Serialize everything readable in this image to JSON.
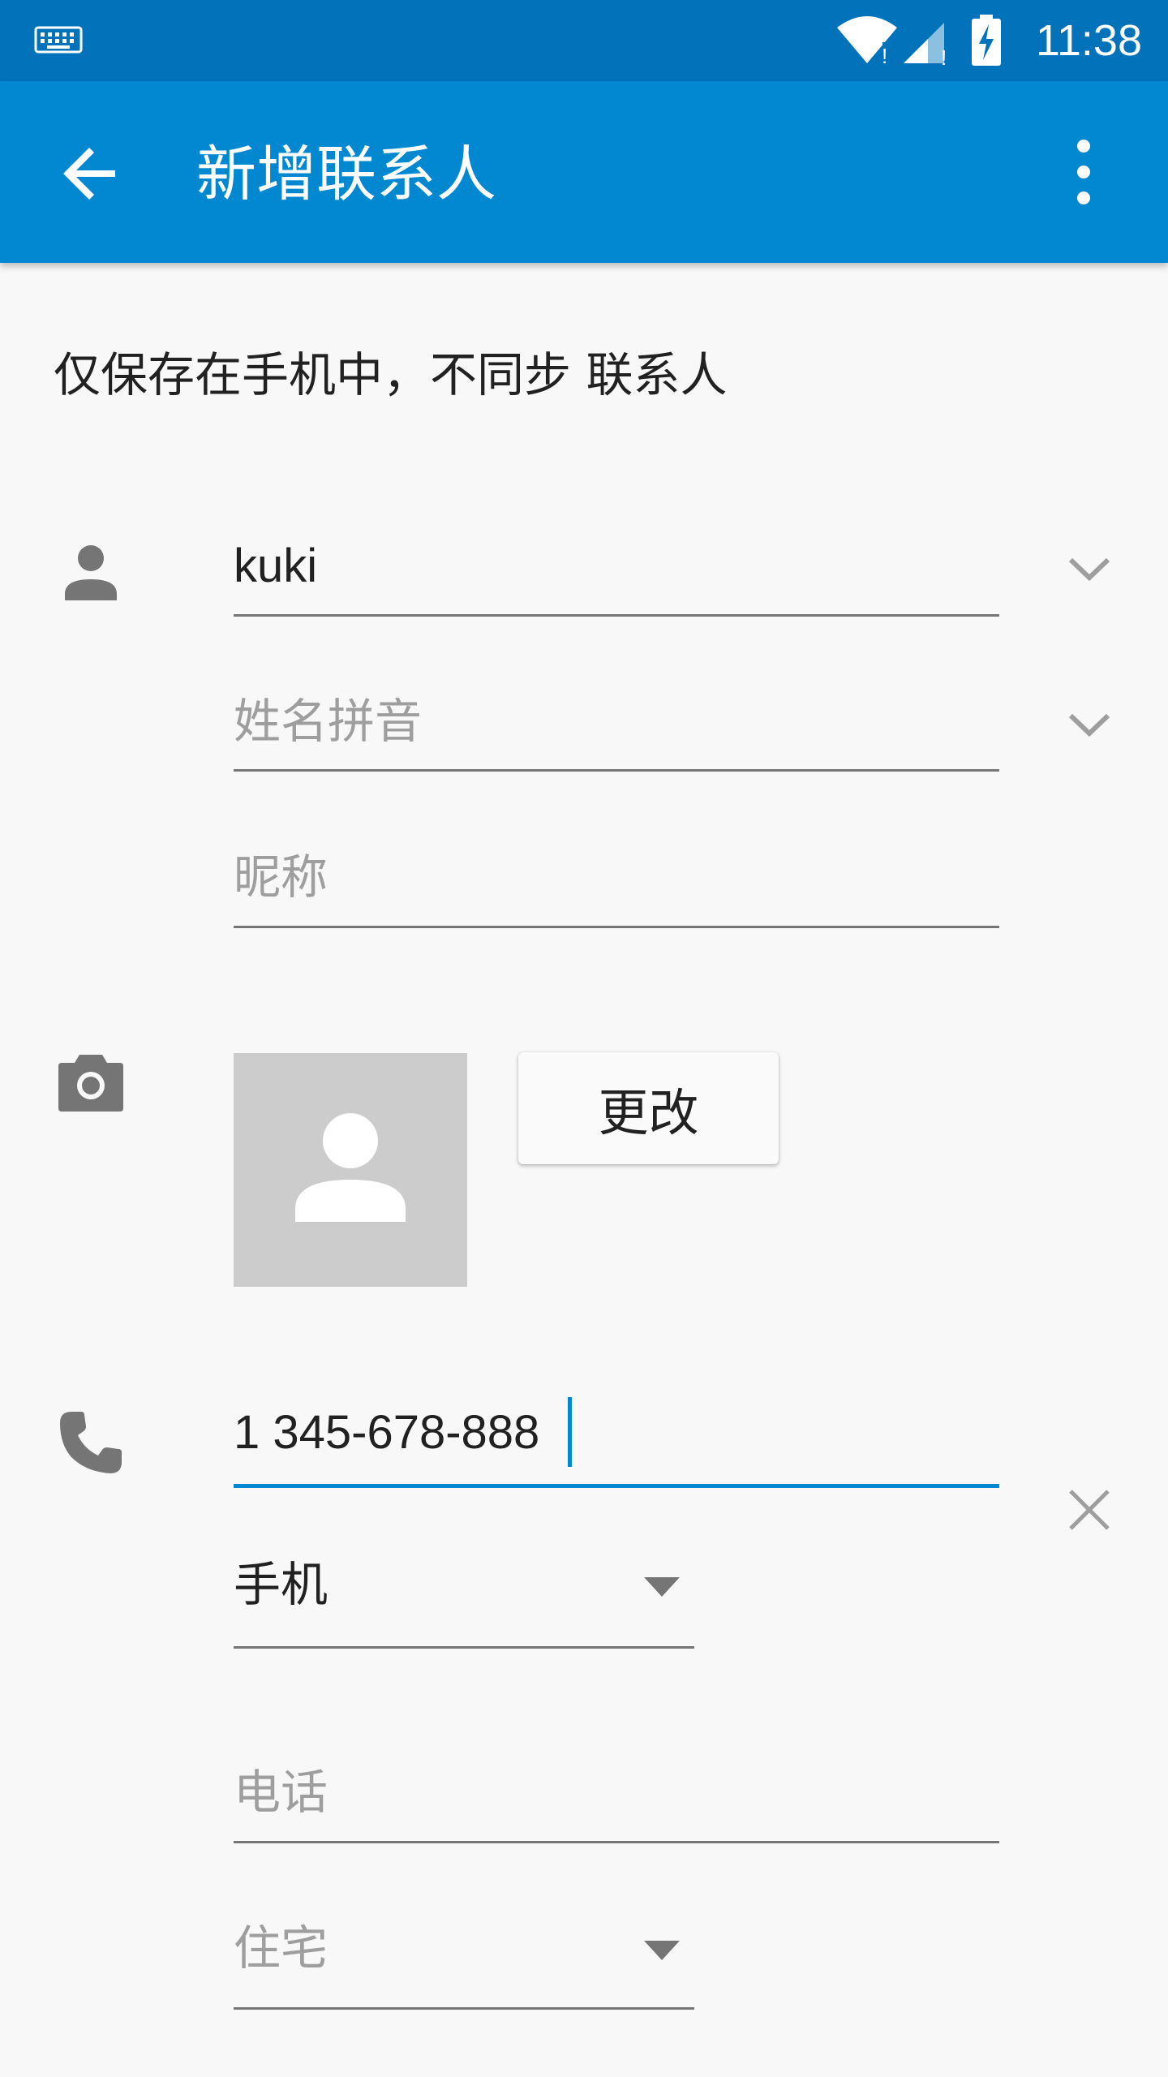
{
  "status_bar": {
    "time": "11:38",
    "icons": [
      "keyboard-icon",
      "wifi-icon",
      "cell-signal-icon",
      "battery-charging-icon"
    ]
  },
  "app_bar": {
    "title": "新增联系人",
    "back_icon": "arrow-back-icon",
    "menu_icon": "more-vert-icon"
  },
  "notice": "仅保存在手机中，不同步 联系人",
  "name_section": {
    "icon": "person-icon",
    "name_value": "kuki",
    "phonetic_placeholder": "姓名拼音",
    "nickname_placeholder": "昵称",
    "expand_icon": "chevron-down-icon"
  },
  "photo_section": {
    "icon": "camera-icon",
    "change_label": "更改",
    "placeholder_icon": "person-placeholder-icon"
  },
  "phone_section": {
    "icon": "phone-icon",
    "phone_value": "1 345-678-888",
    "type_value": "手机",
    "clear_icon": "close-icon",
    "second_phone_placeholder": "电话",
    "second_type_value": "住宅"
  },
  "colors": {
    "status_bar": "#0273bb",
    "app_bar": "#0288d1",
    "accent": "#0288d1",
    "background": "#f8f8f8"
  }
}
